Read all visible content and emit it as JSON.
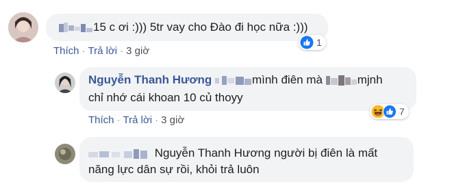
{
  "comments": [
    {
      "text": "15 c ơi :))) 5tr vay cho Đào đi học nữa :)))",
      "actions": {
        "like": "Thích",
        "reply": "Trả lời",
        "time": "3 giờ"
      },
      "reactions": {
        "count": "1",
        "icons": [
          "like-icon"
        ]
      }
    },
    {
      "author": "Nguyễn Thanh Hương",
      "text_a": "mình điên mà",
      "text_b": "mjnh",
      "line2": "chỉ nhớ cái khoan 10 củ thoyy",
      "actions": {
        "like": "Thích",
        "reply": "Trả lời",
        "time": "3 giờ"
      },
      "reactions": {
        "count": "7",
        "icons": [
          "haha-icon",
          "like-icon"
        ]
      }
    },
    {
      "text_line1": "Nguyễn Thanh Hương người bị điên là mất",
      "text_line2": "năng lực dân sự rồi, khỏi trả luôn"
    }
  ],
  "colors": {
    "link": "#385898",
    "bubble": "#f2f3f5",
    "like_blue": "#1877f2",
    "haha_yellow": "#f7b928"
  }
}
